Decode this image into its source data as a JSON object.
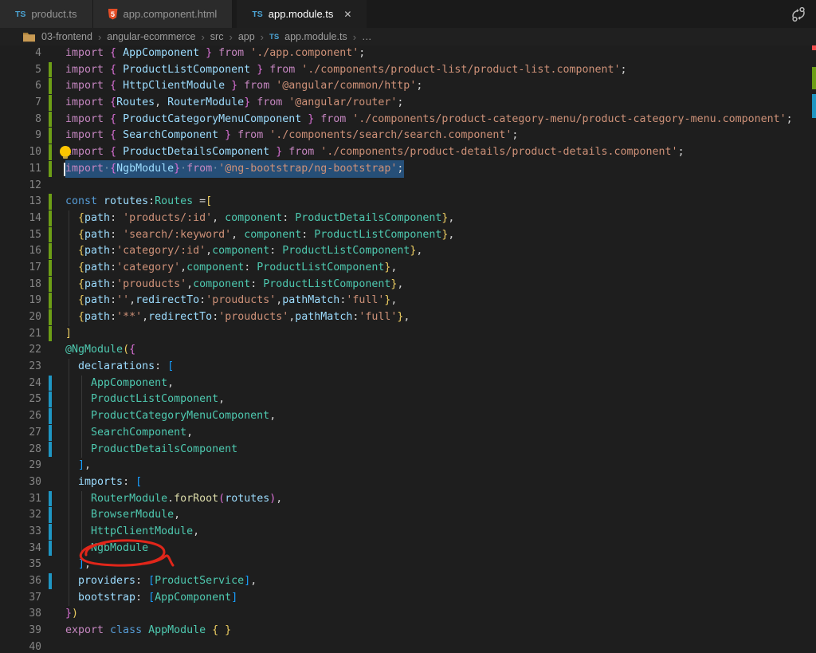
{
  "tabs": [
    {
      "label": "product.ts",
      "icon": "ts",
      "active": false
    },
    {
      "label": "app.component.html",
      "icon": "html",
      "active": false
    },
    {
      "label": "app.module.ts",
      "icon": "ts",
      "active": true,
      "close_label": "✕"
    }
  ],
  "bar_actions": {
    "compare_icon": "split-compare-icon"
  },
  "breadcrumb": {
    "items": [
      "03-frontend",
      "angular-ecommerce",
      "src",
      "app"
    ],
    "file": "app.module.ts",
    "separator": "›",
    "overflow": "…"
  },
  "palette": {
    "kw": "#C586C0",
    "kw2": "#569CD6",
    "ty": "#4EC9B0",
    "id": "#9CDCFE",
    "st": "#CE9178",
    "fn": "#DCDCAA",
    "pu": "#D4D4D4",
    "b1": "#EFCF62",
    "b2": "#DA70D6",
    "b3": "#179FFF",
    "ws": "#7d95aa",
    "selection": "#264f78",
    "gutter_added": "#6d9e16",
    "gutter_modified": "#1f96c3",
    "annotation_red": "#e0261a",
    "lightbulb_yellow": "#fdc500"
  },
  "overview_marks": [
    {
      "c": "#f14c4c",
      "y": 0,
      "h": 6
    },
    {
      "c": "#6d9e16",
      "y": 27,
      "h": 28
    },
    {
      "c": "#1f96c3",
      "y": 61,
      "h": 30
    }
  ],
  "editor": {
    "lines": [
      {
        "n": 4,
        "m": "",
        "g": 0,
        "tk": [
          [
            "import ",
            "kw"
          ],
          [
            "{ ",
            "b2"
          ],
          [
            "AppComponent ",
            "id"
          ],
          [
            "} ",
            "b2"
          ],
          [
            "from ",
            "kw"
          ],
          [
            "'./app.component'",
            "st"
          ],
          [
            ";",
            "pu"
          ]
        ]
      },
      {
        "n": 5,
        "m": "a",
        "g": 0,
        "tk": [
          [
            "import ",
            "kw"
          ],
          [
            "{ ",
            "b2"
          ],
          [
            "ProductListComponent ",
            "id"
          ],
          [
            "} ",
            "b2"
          ],
          [
            "from ",
            "kw"
          ],
          [
            "'./components/product-list/product-list.component'",
            "st"
          ],
          [
            ";",
            "pu"
          ]
        ]
      },
      {
        "n": 6,
        "m": "a",
        "g": 0,
        "tk": [
          [
            "import ",
            "kw"
          ],
          [
            "{ ",
            "b2"
          ],
          [
            "HttpClientModule ",
            "id"
          ],
          [
            "} ",
            "b2"
          ],
          [
            "from ",
            "kw"
          ],
          [
            "'@angular/common/http'",
            "st"
          ],
          [
            ";",
            "pu"
          ]
        ]
      },
      {
        "n": 7,
        "m": "a",
        "g": 0,
        "tk": [
          [
            "import ",
            "kw"
          ],
          [
            "{",
            "b2"
          ],
          [
            "Routes",
            "id"
          ],
          [
            ", ",
            "pu"
          ],
          [
            "RouterModule",
            "id"
          ],
          [
            "} ",
            "b2"
          ],
          [
            "from ",
            "kw"
          ],
          [
            "'@angular/router'",
            "st"
          ],
          [
            ";",
            "pu"
          ]
        ]
      },
      {
        "n": 8,
        "m": "a",
        "g": 0,
        "tk": [
          [
            "import ",
            "kw"
          ],
          [
            "{ ",
            "b2"
          ],
          [
            "ProductCategoryMenuComponent ",
            "id"
          ],
          [
            "} ",
            "b2"
          ],
          [
            "from ",
            "kw"
          ],
          [
            "'./components/product-category-menu/product-category-menu.component'",
            "st"
          ],
          [
            ";",
            "pu"
          ]
        ]
      },
      {
        "n": 9,
        "m": "a",
        "g": 0,
        "tk": [
          [
            "import ",
            "kw"
          ],
          [
            "{ ",
            "b2"
          ],
          [
            "SearchComponent ",
            "id"
          ],
          [
            "} ",
            "b2"
          ],
          [
            "from ",
            "kw"
          ],
          [
            "'./components/search/search.component'",
            "st"
          ],
          [
            ";",
            "pu"
          ]
        ]
      },
      {
        "n": 10,
        "m": "a",
        "g": 0,
        "bulb": true,
        "tk": [
          [
            "import ",
            "kw"
          ],
          [
            "{ ",
            "b2"
          ],
          [
            "ProductDetailsComponent ",
            "id"
          ],
          [
            "} ",
            "b2"
          ],
          [
            "from ",
            "kw"
          ],
          [
            "'./components/product-details/product-details.component'",
            "st"
          ],
          [
            ";",
            "pu"
          ]
        ]
      },
      {
        "n": 11,
        "m": "a",
        "g": 0,
        "sel": true,
        "cursor": true,
        "tk": [
          [
            "import",
            "kw"
          ],
          [
            "·",
            "ws"
          ],
          [
            "{",
            "b2"
          ],
          [
            "NgbModule",
            "id"
          ],
          [
            "}",
            "b2"
          ],
          [
            "·",
            "ws"
          ],
          [
            "from",
            "kw"
          ],
          [
            "·",
            "ws"
          ],
          [
            "'@ng-bootstrap/ng-bootstrap'",
            "st"
          ],
          [
            ";",
            "pu"
          ]
        ]
      },
      {
        "n": 12,
        "m": "",
        "g": 0,
        "tk": []
      },
      {
        "n": 13,
        "m": "a",
        "g": 0,
        "tk": [
          [
            "const ",
            "kw2"
          ],
          [
            "rotutes",
            "id"
          ],
          [
            ":",
            "pu"
          ],
          [
            "Routes",
            "ty"
          ],
          [
            " =",
            "pu"
          ],
          [
            "[",
            "b1"
          ]
        ]
      },
      {
        "n": 14,
        "m": "a",
        "g": 1,
        "tk": [
          [
            "  ",
            "pu"
          ],
          [
            "{",
            "b1"
          ],
          [
            "path",
            "id"
          ],
          [
            ": ",
            "pu"
          ],
          [
            "'products/:id'",
            "st"
          ],
          [
            ", ",
            "pu"
          ],
          [
            "component",
            "ty"
          ],
          [
            ": ",
            "pu"
          ],
          [
            "ProductDetailsComponent",
            "ty"
          ],
          [
            "}",
            "b1"
          ],
          [
            ",",
            "pu"
          ]
        ]
      },
      {
        "n": 15,
        "m": "a",
        "g": 1,
        "tk": [
          [
            "  ",
            "pu"
          ],
          [
            "{",
            "b1"
          ],
          [
            "path",
            "id"
          ],
          [
            ": ",
            "pu"
          ],
          [
            "'search/:keyword'",
            "st"
          ],
          [
            ", ",
            "pu"
          ],
          [
            "component",
            "ty"
          ],
          [
            ": ",
            "pu"
          ],
          [
            "ProductListComponent",
            "ty"
          ],
          [
            "}",
            "b1"
          ],
          [
            ",",
            "pu"
          ]
        ]
      },
      {
        "n": 16,
        "m": "a",
        "g": 1,
        "tk": [
          [
            "  ",
            "pu"
          ],
          [
            "{",
            "b1"
          ],
          [
            "path",
            "id"
          ],
          [
            ":",
            "pu"
          ],
          [
            "'category/:id'",
            "st"
          ],
          [
            ",",
            "pu"
          ],
          [
            "component",
            "ty"
          ],
          [
            ": ",
            "pu"
          ],
          [
            "ProductListComponent",
            "ty"
          ],
          [
            "}",
            "b1"
          ],
          [
            ",",
            "pu"
          ]
        ]
      },
      {
        "n": 17,
        "m": "a",
        "g": 1,
        "tk": [
          [
            "  ",
            "pu"
          ],
          [
            "{",
            "b1"
          ],
          [
            "path",
            "id"
          ],
          [
            ":",
            "pu"
          ],
          [
            "'category'",
            "st"
          ],
          [
            ",",
            "pu"
          ],
          [
            "component",
            "ty"
          ],
          [
            ": ",
            "pu"
          ],
          [
            "ProductListComponent",
            "ty"
          ],
          [
            "}",
            "b1"
          ],
          [
            ",",
            "pu"
          ]
        ]
      },
      {
        "n": 18,
        "m": "a",
        "g": 1,
        "tk": [
          [
            "  ",
            "pu"
          ],
          [
            "{",
            "b1"
          ],
          [
            "path",
            "id"
          ],
          [
            ":",
            "pu"
          ],
          [
            "'prouducts'",
            "st"
          ],
          [
            ",",
            "pu"
          ],
          [
            "component",
            "ty"
          ],
          [
            ": ",
            "pu"
          ],
          [
            "ProductListComponent",
            "ty"
          ],
          [
            "}",
            "b1"
          ],
          [
            ",",
            "pu"
          ]
        ]
      },
      {
        "n": 19,
        "m": "a",
        "g": 1,
        "tk": [
          [
            "  ",
            "pu"
          ],
          [
            "{",
            "b1"
          ],
          [
            "path",
            "id"
          ],
          [
            ":",
            "pu"
          ],
          [
            "''",
            "st"
          ],
          [
            ",",
            "pu"
          ],
          [
            "redirectTo",
            "id"
          ],
          [
            ":",
            "pu"
          ],
          [
            "'prouducts'",
            "st"
          ],
          [
            ",",
            "pu"
          ],
          [
            "pathMatch",
            "id"
          ],
          [
            ":",
            "pu"
          ],
          [
            "'full'",
            "st"
          ],
          [
            "}",
            "b1"
          ],
          [
            ",",
            "pu"
          ]
        ]
      },
      {
        "n": 20,
        "m": "a",
        "g": 1,
        "tk": [
          [
            "  ",
            "pu"
          ],
          [
            "{",
            "b1"
          ],
          [
            "path",
            "id"
          ],
          [
            ":",
            "pu"
          ],
          [
            "'**'",
            "st"
          ],
          [
            ",",
            "pu"
          ],
          [
            "redirectTo",
            "id"
          ],
          [
            ":",
            "pu"
          ],
          [
            "'prouducts'",
            "st"
          ],
          [
            ",",
            "pu"
          ],
          [
            "pathMatch",
            "id"
          ],
          [
            ":",
            "pu"
          ],
          [
            "'full'",
            "st"
          ],
          [
            "}",
            "b1"
          ],
          [
            ",",
            "pu"
          ]
        ]
      },
      {
        "n": 21,
        "m": "a",
        "g": 0,
        "tk": [
          [
            "]",
            "b1"
          ]
        ]
      },
      {
        "n": 22,
        "m": "",
        "g": 0,
        "tk": [
          [
            "@NgModule",
            "ty"
          ],
          [
            "(",
            "b1"
          ],
          [
            "{",
            "b2"
          ]
        ]
      },
      {
        "n": 23,
        "m": "",
        "g": 1,
        "tk": [
          [
            "  ",
            "pu"
          ],
          [
            "declarations",
            "id"
          ],
          [
            ": ",
            "pu"
          ],
          [
            "[",
            "b3"
          ]
        ]
      },
      {
        "n": 24,
        "m": "m",
        "g": 2,
        "tk": [
          [
            "    ",
            "pu"
          ],
          [
            "AppComponent",
            "ty"
          ],
          [
            ",",
            "pu"
          ]
        ]
      },
      {
        "n": 25,
        "m": "m",
        "g": 2,
        "tk": [
          [
            "    ",
            "pu"
          ],
          [
            "ProductListComponent",
            "ty"
          ],
          [
            ",",
            "pu"
          ]
        ]
      },
      {
        "n": 26,
        "m": "m",
        "g": 2,
        "tk": [
          [
            "    ",
            "pu"
          ],
          [
            "ProductCategoryMenuComponent",
            "ty"
          ],
          [
            ",",
            "pu"
          ]
        ]
      },
      {
        "n": 27,
        "m": "m",
        "g": 2,
        "tk": [
          [
            "    ",
            "pu"
          ],
          [
            "SearchComponent",
            "ty"
          ],
          [
            ",",
            "pu"
          ]
        ]
      },
      {
        "n": 28,
        "m": "m",
        "g": 2,
        "tk": [
          [
            "    ",
            "pu"
          ],
          [
            "ProductDetailsComponent",
            "ty"
          ]
        ]
      },
      {
        "n": 29,
        "m": "",
        "g": 1,
        "tk": [
          [
            "  ",
            "pu"
          ],
          [
            "]",
            "b3"
          ],
          [
            ",",
            "pu"
          ]
        ]
      },
      {
        "n": 30,
        "m": "",
        "g": 1,
        "tk": [
          [
            "  ",
            "pu"
          ],
          [
            "imports",
            "id"
          ],
          [
            ": ",
            "pu"
          ],
          [
            "[",
            "b3"
          ]
        ]
      },
      {
        "n": 31,
        "m": "m",
        "g": 2,
        "tk": [
          [
            "    ",
            "pu"
          ],
          [
            "RouterModule",
            "ty"
          ],
          [
            ".",
            "pu"
          ],
          [
            "forRoot",
            "fn"
          ],
          [
            "(",
            "b2"
          ],
          [
            "rotutes",
            "id"
          ],
          [
            ")",
            "b2"
          ],
          [
            ",",
            "pu"
          ]
        ]
      },
      {
        "n": 32,
        "m": "m",
        "g": 2,
        "tk": [
          [
            "    ",
            "pu"
          ],
          [
            "BrowserModule",
            "ty"
          ],
          [
            ",",
            "pu"
          ]
        ]
      },
      {
        "n": 33,
        "m": "m",
        "g": 2,
        "tk": [
          [
            "    ",
            "pu"
          ],
          [
            "HttpClientModule",
            "ty"
          ],
          [
            ",",
            "pu"
          ]
        ]
      },
      {
        "n": 34,
        "m": "m",
        "g": 2,
        "circle": true,
        "tk": [
          [
            "    ",
            "pu"
          ],
          [
            "NgbModule",
            "ty"
          ]
        ]
      },
      {
        "n": 35,
        "m": "",
        "g": 1,
        "tk": [
          [
            "  ",
            "pu"
          ],
          [
            "]",
            "b3"
          ],
          [
            ",",
            "pu"
          ]
        ]
      },
      {
        "n": 36,
        "m": "m",
        "g": 1,
        "tk": [
          [
            "  ",
            "pu"
          ],
          [
            "providers",
            "id"
          ],
          [
            ": ",
            "pu"
          ],
          [
            "[",
            "b3"
          ],
          [
            "ProductService",
            "ty"
          ],
          [
            "]",
            "b3"
          ],
          [
            ",",
            "pu"
          ]
        ]
      },
      {
        "n": 37,
        "m": "",
        "g": 1,
        "tk": [
          [
            "  ",
            "pu"
          ],
          [
            "bootstrap",
            "id"
          ],
          [
            ": ",
            "pu"
          ],
          [
            "[",
            "b3"
          ],
          [
            "AppComponent",
            "ty"
          ],
          [
            "]",
            "b3"
          ]
        ]
      },
      {
        "n": 38,
        "m": "",
        "g": 0,
        "tk": [
          [
            "}",
            "b2"
          ],
          [
            ")",
            "b1"
          ]
        ]
      },
      {
        "n": 39,
        "m": "",
        "g": 0,
        "tk": [
          [
            "export ",
            "kw"
          ],
          [
            "class ",
            "kw2"
          ],
          [
            "AppModule ",
            "ty"
          ],
          [
            "{ }",
            "b1"
          ]
        ]
      },
      {
        "n": 40,
        "m": "",
        "g": 0,
        "tk": []
      }
    ]
  }
}
